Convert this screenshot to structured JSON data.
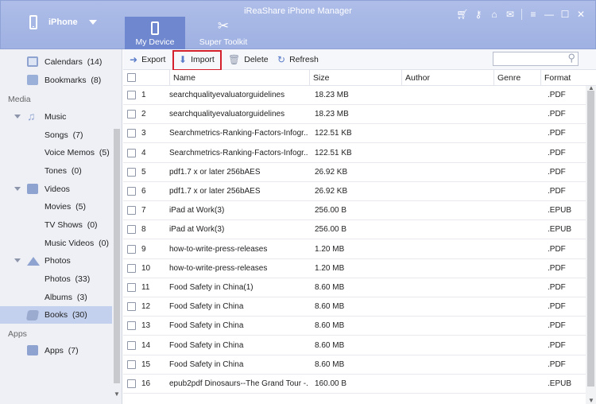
{
  "app": {
    "title": "iReaShare iPhone Manager",
    "device_name": "iPhone",
    "tabs": [
      {
        "label": "My Device",
        "icon": "phone-icon",
        "active": true
      },
      {
        "label": "Super Toolkit",
        "icon": "tools-icon",
        "active": false
      }
    ],
    "accent_color": "#a4b5e4"
  },
  "sidebar": {
    "items_top": [
      {
        "label": "Calendars",
        "count": "(14)",
        "icon": "calendar-icon"
      },
      {
        "label": "Bookmarks",
        "count": "(8)",
        "icon": "bookmark-icon"
      }
    ],
    "section_media": "Media",
    "music": {
      "label": "Music",
      "children": [
        {
          "label": "Songs",
          "count": "(7)"
        },
        {
          "label": "Voice Memos",
          "count": "(5)"
        },
        {
          "label": "Tones",
          "count": "(0)"
        }
      ]
    },
    "videos": {
      "label": "Videos",
      "children": [
        {
          "label": "Movies",
          "count": "(5)"
        },
        {
          "label": "TV Shows",
          "count": "(0)"
        },
        {
          "label": "Music Videos",
          "count": "(0)"
        }
      ]
    },
    "photos": {
      "label": "Photos",
      "children": [
        {
          "label": "Photos",
          "count": "(33)"
        },
        {
          "label": "Albums",
          "count": "(3)"
        }
      ]
    },
    "books": {
      "label": "Books",
      "count": "(30)",
      "selected": true
    },
    "section_apps": "Apps",
    "apps": {
      "label": "Apps",
      "count": "(7)"
    }
  },
  "toolbar": {
    "export_label": "Export",
    "import_label": "Import",
    "delete_label": "Delete",
    "refresh_label": "Refresh",
    "search_placeholder": ""
  },
  "table": {
    "columns": [
      "Name",
      "Size",
      "Author",
      "Genre",
      "Format"
    ],
    "rows": [
      {
        "num": "1",
        "name": "searchqualityevaluatorguidelines",
        "size": "18.23 MB",
        "author": "",
        "genre": "",
        "format": ".PDF"
      },
      {
        "num": "2",
        "name": "searchqualityevaluatorguidelines",
        "size": "18.23 MB",
        "author": "",
        "genre": "",
        "format": ".PDF"
      },
      {
        "num": "3",
        "name": "Searchmetrics-Ranking-Factors-Infogr...",
        "size": "122.51 KB",
        "author": "",
        "genre": "",
        "format": ".PDF"
      },
      {
        "num": "4",
        "name": "Searchmetrics-Ranking-Factors-Infogr...",
        "size": "122.51 KB",
        "author": "",
        "genre": "",
        "format": ".PDF"
      },
      {
        "num": "5",
        "name": "pdf1.7 x or later 256bAES",
        "size": "26.92 KB",
        "author": "",
        "genre": "",
        "format": ".PDF"
      },
      {
        "num": "6",
        "name": "pdf1.7 x or later 256bAES",
        "size": "26.92 KB",
        "author": "",
        "genre": "",
        "format": ".PDF"
      },
      {
        "num": "7",
        "name": "iPad at Work(3)",
        "size": "256.00 B",
        "author": "",
        "genre": "",
        "format": ".EPUB"
      },
      {
        "num": "8",
        "name": "iPad at Work(3)",
        "size": "256.00 B",
        "author": "",
        "genre": "",
        "format": ".EPUB"
      },
      {
        "num": "9",
        "name": "how-to-write-press-releases",
        "size": "1.20 MB",
        "author": "",
        "genre": "",
        "format": ".PDF"
      },
      {
        "num": "10",
        "name": "how-to-write-press-releases",
        "size": "1.20 MB",
        "author": "",
        "genre": "",
        "format": ".PDF"
      },
      {
        "num": "11",
        "name": "Food Safety in China(1)",
        "size": "8.60 MB",
        "author": "",
        "genre": "",
        "format": ".PDF"
      },
      {
        "num": "12",
        "name": "Food Safety in China",
        "size": "8.60 MB",
        "author": "",
        "genre": "",
        "format": ".PDF"
      },
      {
        "num": "13",
        "name": "Food Safety in China",
        "size": "8.60 MB",
        "author": "",
        "genre": "",
        "format": ".PDF"
      },
      {
        "num": "14",
        "name": "Food Safety in China",
        "size": "8.60 MB",
        "author": "",
        "genre": "",
        "format": ".PDF"
      },
      {
        "num": "15",
        "name": "Food Safety in China",
        "size": "8.60 MB",
        "author": "",
        "genre": "",
        "format": ".PDF"
      },
      {
        "num": "16",
        "name": "epub2pdf Dinosaurs--The Grand Tour -...",
        "size": "160.00 B",
        "author": "",
        "genre": "",
        "format": ".EPUB"
      }
    ]
  }
}
